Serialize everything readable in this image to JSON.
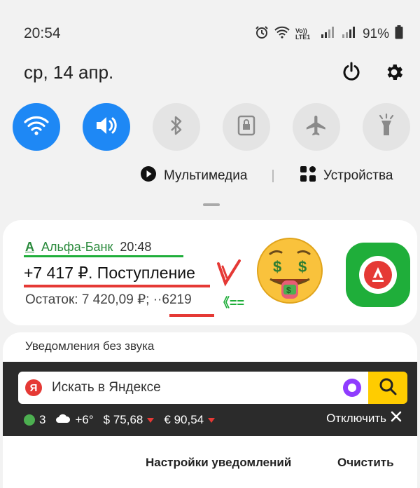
{
  "status": {
    "time": "20:54",
    "network_label": "Vo)) LTE1",
    "battery": "91%"
  },
  "header": {
    "date": "ср, 14 апр."
  },
  "quick_settings": [
    {
      "name": "wifi-icon",
      "state": "on"
    },
    {
      "name": "sound-icon",
      "state": "on"
    },
    {
      "name": "bluetooth-icon",
      "state": "off"
    },
    {
      "name": "rotation-lock-icon",
      "state": "off"
    },
    {
      "name": "airplane-icon",
      "state": "off"
    },
    {
      "name": "flashlight-icon",
      "state": "off"
    }
  ],
  "media_row": {
    "media_label": "Мультимедиа",
    "devices_label": "Устройства"
  },
  "notification": {
    "app_name": "Альфа-Банк",
    "time": "20:48",
    "title": "+7 417 ₽. Поступление",
    "body": "Остаток: 7 420,09 ₽; ··6219",
    "arrow": "《=="
  },
  "silent": {
    "title": "Уведомления без звука"
  },
  "yandex": {
    "logo": "Я",
    "search_placeholder": "Искать в Яндексе",
    "traffic": "3",
    "weather": "+6°",
    "usd": "$ 75,68",
    "eur": "€ 90,54",
    "disable": "Отключить"
  },
  "actions": {
    "settings": "Настройки уведомлений",
    "clear": "Очистить"
  },
  "colors": {
    "accent_blue": "#1e88f5",
    "alfa_green": "#1fae3a",
    "alfa_red": "#e53935",
    "yandex_yellow": "#ffcc00"
  }
}
